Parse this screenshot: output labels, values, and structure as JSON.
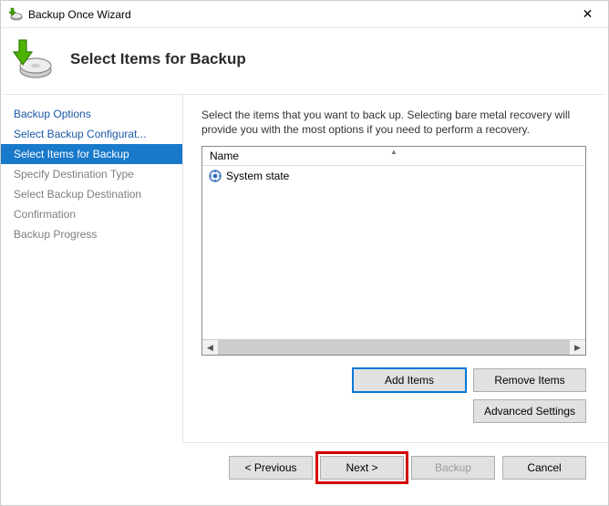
{
  "window": {
    "title": "Backup Once Wizard"
  },
  "page_title": "Select Items for Backup",
  "steps": [
    {
      "label": "Backup Options",
      "state": "done"
    },
    {
      "label": "Select Backup Configurat...",
      "state": "done"
    },
    {
      "label": "Select Items for Backup",
      "state": "current"
    },
    {
      "label": "Specify Destination Type",
      "state": "future"
    },
    {
      "label": "Select Backup Destination",
      "state": "future"
    },
    {
      "label": "Confirmation",
      "state": "future"
    },
    {
      "label": "Backup Progress",
      "state": "future"
    }
  ],
  "instruction": "Select the items that you want to back up. Selecting bare metal recovery will provide you with the most options if you need to perform a recovery.",
  "listview": {
    "columns": [
      {
        "label": "Name"
      }
    ],
    "rows": [
      {
        "icon": "system-state-icon",
        "label": "System state"
      }
    ]
  },
  "buttons": {
    "add_items": "Add Items",
    "remove_items": "Remove Items",
    "advanced": "Advanced Settings",
    "previous": "< Previous",
    "next": "Next >",
    "backup": "Backup",
    "cancel": "Cancel"
  }
}
